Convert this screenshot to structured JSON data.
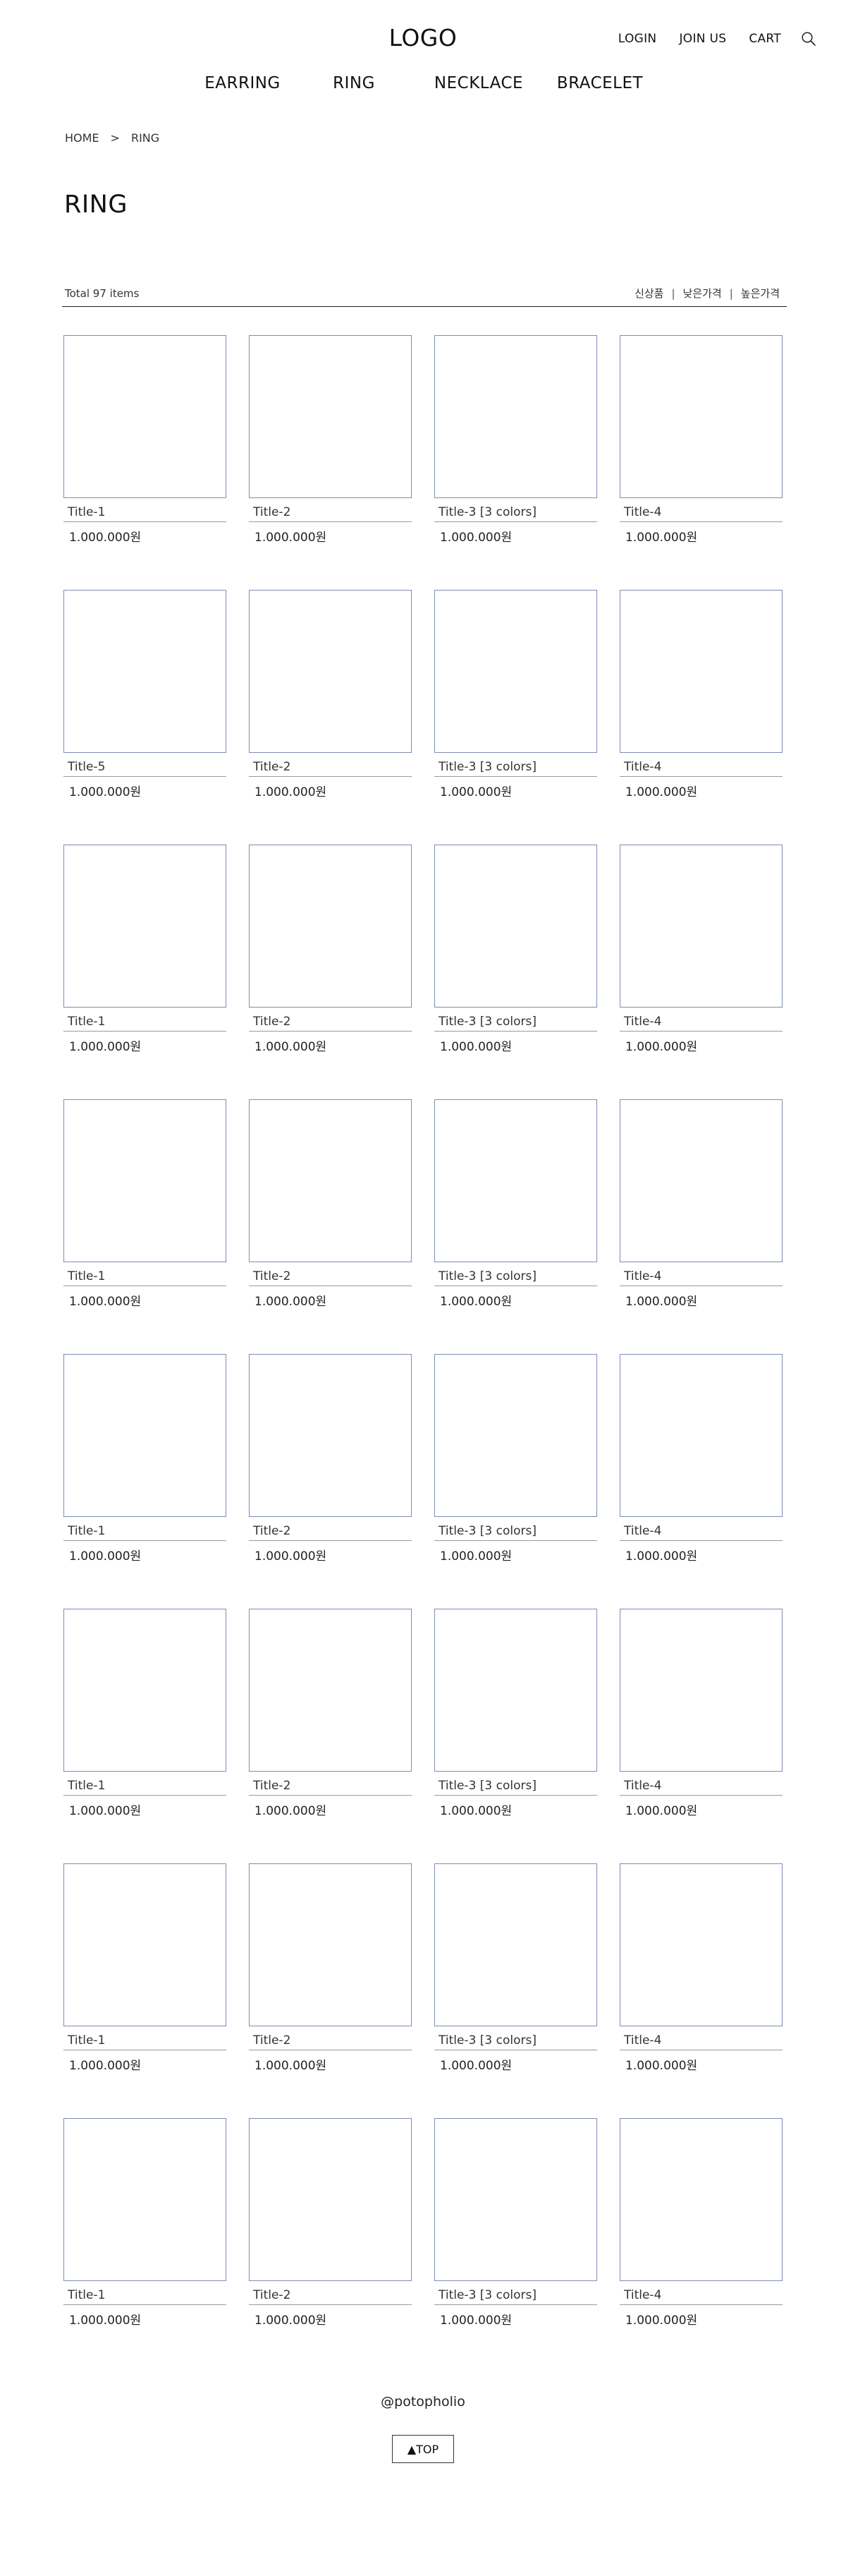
{
  "header": {
    "logo": "LOGO",
    "util_links": [
      "LOGIN",
      "JOIN US",
      "CART"
    ],
    "search_icon": "search-icon"
  },
  "gnb": [
    "EARRING",
    "RING",
    "NECKLACE",
    "BRACELET"
  ],
  "breadcrumb": {
    "home": "HOME",
    "separator": ">",
    "current": "RING"
  },
  "page_title": "RING",
  "toolbar": {
    "total": "Total 97 items",
    "sort_options": [
      "신상품",
      "낮은가격",
      "높은가격"
    ],
    "separator": "|"
  },
  "products": [
    {
      "name": "Title-1",
      "price": "1.000.000원"
    },
    {
      "name": "Title-2",
      "price": "1.000.000원"
    },
    {
      "name": "Title-3 [3 colors]",
      "price": "1.000.000원"
    },
    {
      "name": "Title-4",
      "price": "1.000.000원"
    },
    {
      "name": "Title-5",
      "price": "1.000.000원"
    },
    {
      "name": "Title-2",
      "price": "1.000.000원"
    },
    {
      "name": "Title-3 [3 colors]",
      "price": "1.000.000원"
    },
    {
      "name": "Title-4",
      "price": "1.000.000원"
    },
    {
      "name": "Title-1",
      "price": "1.000.000원"
    },
    {
      "name": "Title-2",
      "price": "1.000.000원"
    },
    {
      "name": "Title-3 [3 colors]",
      "price": "1.000.000원"
    },
    {
      "name": "Title-4",
      "price": "1.000.000원"
    },
    {
      "name": "Title-1",
      "price": "1.000.000원"
    },
    {
      "name": "Title-2",
      "price": "1.000.000원"
    },
    {
      "name": "Title-3 [3 colors]",
      "price": "1.000.000원"
    },
    {
      "name": "Title-4",
      "price": "1.000.000원"
    },
    {
      "name": "Title-1",
      "price": "1.000.000원"
    },
    {
      "name": "Title-2",
      "price": "1.000.000원"
    },
    {
      "name": "Title-3 [3 colors]",
      "price": "1.000.000원"
    },
    {
      "name": "Title-4",
      "price": "1.000.000원"
    },
    {
      "name": "Title-1",
      "price": "1.000.000원"
    },
    {
      "name": "Title-2",
      "price": "1.000.000원"
    },
    {
      "name": "Title-3 [3 colors]",
      "price": "1.000.000원"
    },
    {
      "name": "Title-4",
      "price": "1.000.000원"
    },
    {
      "name": "Title-1",
      "price": "1.000.000원"
    },
    {
      "name": "Title-2",
      "price": "1.000.000원"
    },
    {
      "name": "Title-3 [3 colors]",
      "price": "1.000.000원"
    },
    {
      "name": "Title-4",
      "price": "1.000.000원"
    },
    {
      "name": "Title-1",
      "price": "1.000.000원"
    },
    {
      "name": "Title-2",
      "price": "1.000.000원"
    },
    {
      "name": "Title-3 [3 colors]",
      "price": "1.000.000원"
    },
    {
      "name": "Title-4",
      "price": "1.000.000원"
    }
  ],
  "footer": {
    "brand": "@potopholio",
    "top_button": "▲TOP"
  },
  "colors": {
    "thumb_border": "#7e8bb7",
    "text": "#111111",
    "divider": "#9a9a9a"
  }
}
